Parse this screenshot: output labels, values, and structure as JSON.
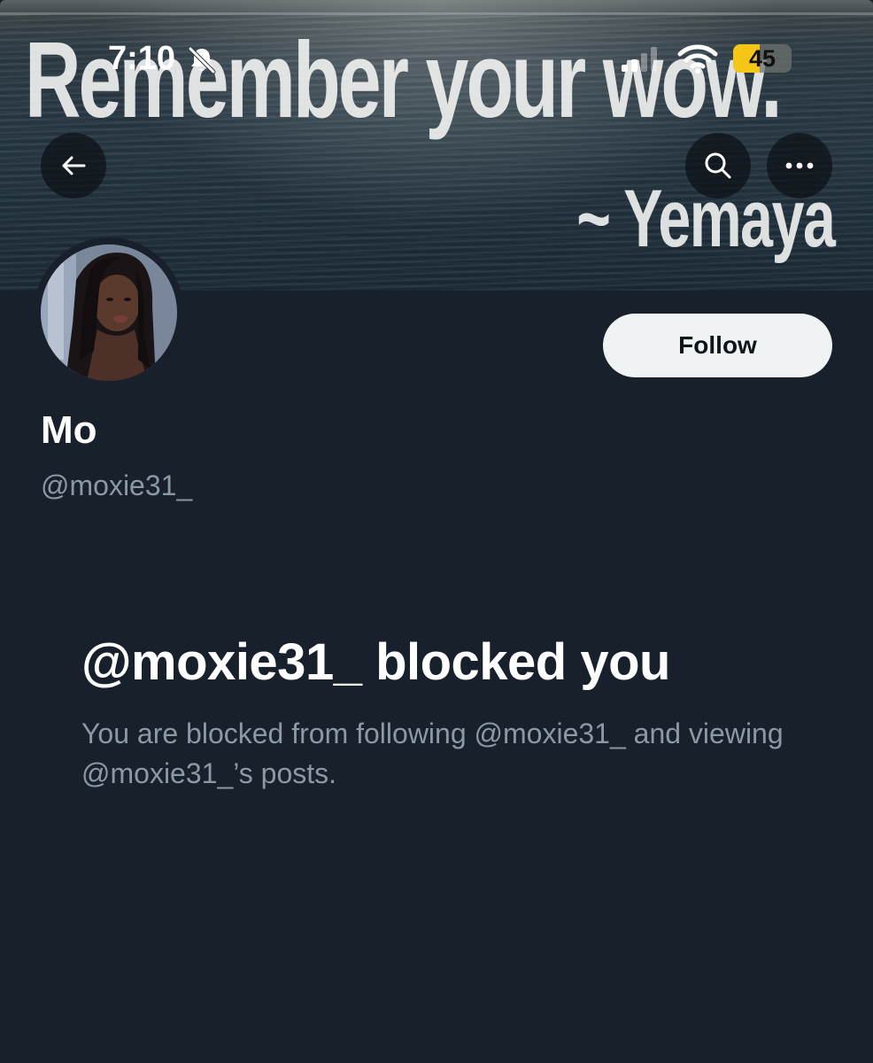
{
  "status_bar": {
    "time": "7:10",
    "battery_level": "45",
    "battery_fraction": 0.45,
    "icons": [
      "bell-slash-icon",
      "signal-icon",
      "wifi-icon",
      "battery-icon"
    ]
  },
  "header": {
    "banner_text_line1": "Remember your wow.",
    "banner_text_line2": "~ Yemaya",
    "buttons": [
      "back-arrow-icon",
      "search-icon",
      "more-icon"
    ]
  },
  "profile": {
    "display_name": "Mo",
    "handle": "@moxie31_",
    "follow_label": "Follow"
  },
  "blocked_notice": {
    "title": "@moxie31_ blocked you",
    "description": "You are blocked from following @moxie31_ and viewing @moxie31_’s posts."
  },
  "colors": {
    "background": "#17202b",
    "follow_button_bg": "#eff3f4",
    "secondary_text": "#8b98a5",
    "battery_accent": "#f5c518"
  }
}
